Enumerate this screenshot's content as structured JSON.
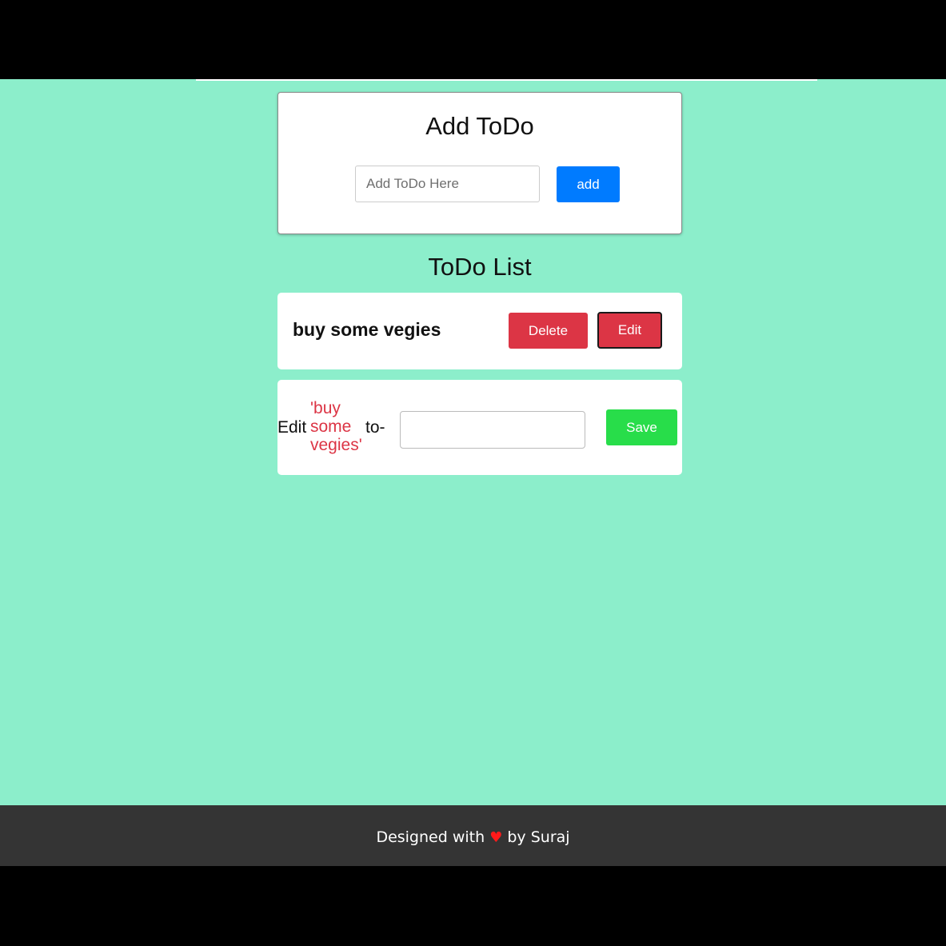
{
  "add_card": {
    "title": "Add ToDo",
    "input_placeholder": "Add ToDo Here",
    "add_label": "add"
  },
  "list": {
    "title": "ToDo List",
    "items": [
      {
        "text": "buy some vegies",
        "delete_label": "Delete",
        "edit_label": "Edit"
      }
    ]
  },
  "edit_panel": {
    "prefix": "Edit",
    "quoted_text": "'buy some vegies'",
    "suffix": "to-",
    "input_value": "",
    "save_label": "Save"
  },
  "footer": {
    "text_before": "Designed with",
    "heart": "♥",
    "text_after": "by Suraj"
  },
  "colors": {
    "background": "#8ceecb",
    "primary": "#007bff",
    "danger": "#dc3545",
    "success": "#28dd4a",
    "footer": "#343434"
  }
}
